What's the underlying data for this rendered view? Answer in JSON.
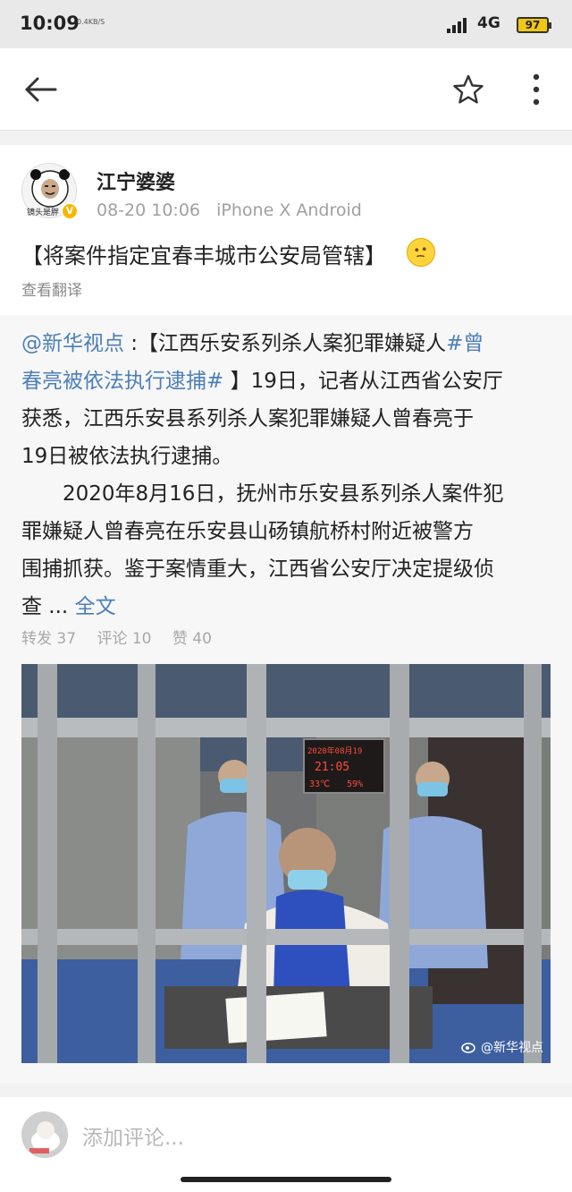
{
  "status": {
    "time": "10:09",
    "speed": "0.4KB/S",
    "network": "4G",
    "battery": "97"
  },
  "post": {
    "username": "江宁婆婆",
    "timestamp": "08-20 10:06",
    "device": "iPhone X Android",
    "avatar_caption": "镜头是胖",
    "headline": "【将案件指定宜春丰城市公安局管辖】",
    "translate_label": "查看翻译"
  },
  "quote": {
    "mention": "@新华视点",
    "colon": " :【江西乐安系列杀人案犯罪嫌疑人",
    "hashtag_part1": "#曾",
    "hashtag_part2": "春亮被依法执行逮捕#",
    "line2_rest": " 】19日，记者从江西省公安厅",
    "line3": "获悉，江西乐安县系列杀人案犯罪嫌疑人曾春亮于",
    "line4": "19日被依法执行逮捕。",
    "line5": "　　2020年8月16日，抚州市乐安县系列杀人案件犯",
    "line6": "罪嫌疑人曾春亮在乐安县山砀镇航桥村附近被警方",
    "line7": "围捕抓获。鉴于案情重大，江西省公安厅决定提级侦",
    "line8_start": "查  ... ",
    "full_text_link": "全文",
    "repost": "转发 37",
    "comment": "评论 10",
    "like": "赞 40"
  },
  "photo": {
    "watermark": "@新华视点",
    "sign_top": "2020年08月19",
    "sign_time": "21:05",
    "sign_temp": "33℃",
    "sign_hum": "59%"
  },
  "comment_bar": {
    "placeholder": "添加评论..."
  },
  "colors": {
    "link": "#4c7fb8",
    "muted": "#a8a8a8",
    "background": "#f2f2f2"
  },
  "icons": {
    "back": "back-arrow-icon",
    "favorite": "star-icon",
    "more": "more-vertical-icon",
    "verified": "verified-v-icon",
    "weibo": "weibo-logo-icon"
  }
}
